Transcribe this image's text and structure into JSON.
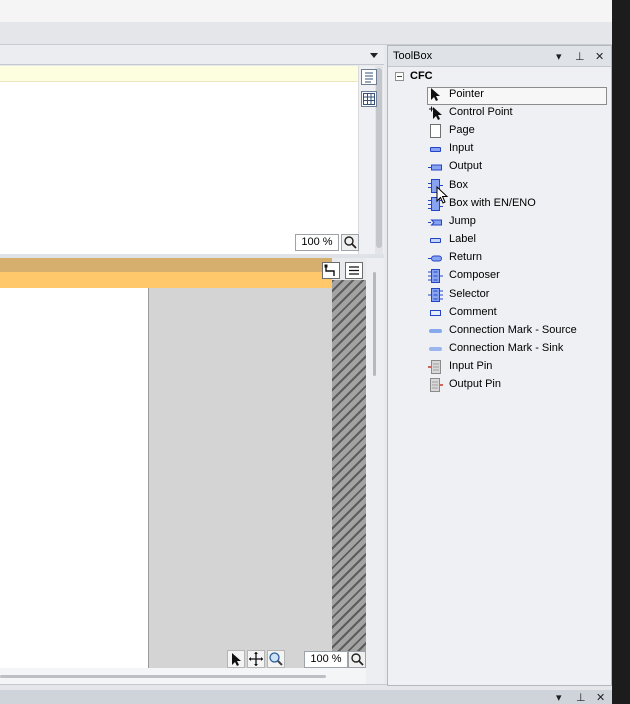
{
  "editor": {
    "upper_zoom": "100 %",
    "lower_zoom": "100 %"
  },
  "toolbox": {
    "title": "ToolBox",
    "header_controls": {
      "dropdown": "▾",
      "pin": "⊥",
      "close": "✕"
    },
    "root": {
      "expander": "−",
      "label": "CFC"
    },
    "items": [
      {
        "label": "Pointer",
        "icon": "pointer-arrow-icon"
      },
      {
        "label": "Control Point",
        "icon": "control-point-icon"
      },
      {
        "label": "Page",
        "icon": "page-icon"
      },
      {
        "label": "Input",
        "icon": "input-icon"
      },
      {
        "label": "Output",
        "icon": "output-icon"
      },
      {
        "label": "Box",
        "icon": "box-icon"
      },
      {
        "label": "Box with EN/ENO",
        "icon": "box-en-eno-icon"
      },
      {
        "label": "Jump",
        "icon": "jump-icon"
      },
      {
        "label": "Label",
        "icon": "label-icon"
      },
      {
        "label": "Return",
        "icon": "return-icon"
      },
      {
        "label": "Composer",
        "icon": "composer-icon"
      },
      {
        "label": "Selector",
        "icon": "selector-icon"
      },
      {
        "label": "Comment",
        "icon": "comment-icon"
      },
      {
        "label": "Connection Mark - Source",
        "icon": "connection-mark-source-icon"
      },
      {
        "label": "Connection Mark - Sink",
        "icon": "connection-mark-sink-icon"
      },
      {
        "label": "Input Pin",
        "icon": "input-pin-icon"
      },
      {
        "label": "Output Pin",
        "icon": "output-pin-icon"
      }
    ]
  },
  "colors": {
    "declaration_bg": "#fdfde0",
    "tab_tan": "#d6ae6e",
    "tab_orange": "#ffc96b",
    "icon_blue": "#2444c8"
  }
}
